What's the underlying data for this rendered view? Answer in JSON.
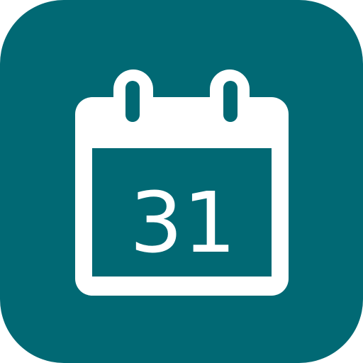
{
  "app_icon": {
    "name": "calendar-app-icon",
    "icon": "calendar-icon",
    "day_number": "31",
    "colors": {
      "tile_background": "#016974",
      "calendar_body": "#ffffff",
      "date_panel": "#016974",
      "day_number_text": "#ffffff"
    }
  }
}
